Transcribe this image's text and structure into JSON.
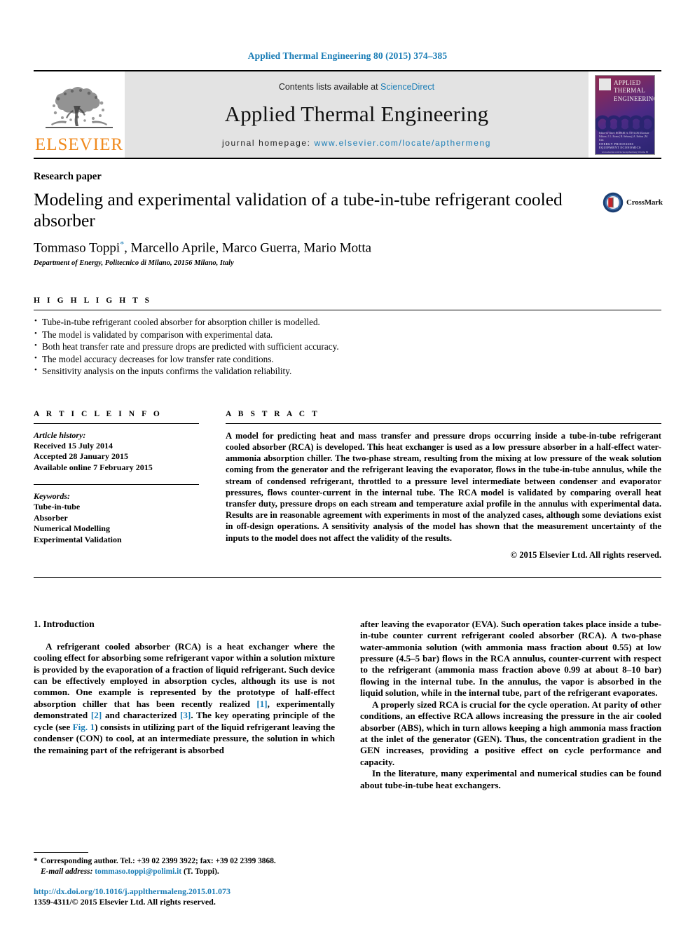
{
  "running_head": "Applied Thermal Engineering 80 (2015) 374–385",
  "masthead": {
    "publisher": "ELSEVIER",
    "contents_prefix": "Contents lists available at ",
    "contents_link": "ScienceDirect",
    "journal_title": "Applied Thermal Engineering",
    "homepage_label": "journal homepage:",
    "homepage_url": "www.elsevier.com/locate/apthermeng",
    "cover": {
      "title_line1": "APPLIED",
      "title_line2": "THERMAL",
      "title_line3": "ENGINEERING",
      "editors": "Editor-in-Chief: ROBERT A. TAYLOR\nAssociate Editors: J. L. Evans  |  R. Selvaraj  |  A. Kribus  |  M. Kim",
      "names": "ENERGY   PROCESSES   EQUIPMENT   ECONOMICS",
      "bottom": "www.elsevier.com/locate/apthermeng\nVolume 80"
    }
  },
  "article": {
    "type": "Research paper",
    "title": "Modeling and experimental validation of a tube-in-tube refrigerant cooled absorber",
    "crossmark_label": "CrossMark",
    "authors": "Tommaso Toppi",
    "author_marker": "*",
    "authors_rest": ", Marcello Aprile, Marco Guerra, Mario Motta",
    "affiliation": "Department of Energy, Politecnico di Milano, 20156 Milano, Italy"
  },
  "highlights": {
    "label": "H I G H L I G H T S",
    "items": [
      "Tube-in-tube refrigerant cooled absorber for absorption chiller is modelled.",
      "The model is validated by comparison with experimental data.",
      "Both heat transfer rate and pressure drops are predicted with sufficient accuracy.",
      "The model accuracy decreases for low transfer rate conditions.",
      "Sensitivity analysis on the inputs confirms the validation reliability."
    ]
  },
  "article_info": {
    "label": "A R T I C L E   I N F O",
    "history_heading": "Article history:",
    "history": [
      "Received 15 July 2014",
      "Accepted 28 January 2015",
      "Available online 7 February 2015"
    ],
    "keywords_heading": "Keywords:",
    "keywords": [
      "Tube-in-tube",
      "Absorber",
      "Numerical Modelling",
      "Experimental Validation"
    ]
  },
  "abstract": {
    "label": "A B S T R A C T",
    "text": "A model for predicting heat and mass transfer and pressure drops occurring inside a tube-in-tube refrigerant cooled absorber (RCA) is developed. This heat exchanger is used as a low pressure absorber in a half-effect water-ammonia absorption chiller. The two-phase stream, resulting from the mixing at low pressure of the weak solution coming from the generator and the refrigerant leaving the evaporator, flows in the tube-in-tube annulus, while the stream of condensed refrigerant, throttled to a pressure level intermediate between condenser and evaporator pressures, flows counter-current in the internal tube. The RCA model is validated by comparing overall heat transfer duty, pressure drops on each stream and temperature axial profile in the annulus with experimental data. Results are in reasonable agreement with experiments in most of the analyzed cases, although some deviations exist in off-design operations. A sensitivity analysis of the model has shown that the measurement uncertainty of the inputs to the model does not affect the validity of the results.",
    "copyright": "© 2015 Elsevier Ltd. All rights reserved."
  },
  "body": {
    "section_title": "1.  Introduction",
    "left_paragraphs": [
      "A refrigerant cooled absorber (RCA) is a heat exchanger where the cooling effect for absorbing some refrigerant vapor within a solution mixture is provided by the evaporation of a fraction of liquid refrigerant. Such device can be effectively employed in absorption cycles, although its use is not common. One example is represented by the prototype of half-effect absorption chiller that has been recently realized [1], experimentally demonstrated [2] and characterized [3]. The key operating principle of the cycle (see Fig. 1) consists in utilizing part of the liquid refrigerant leaving the condenser (CON) to cool, at an intermediate pressure, the solution in which the remaining part of the refrigerant is absorbed"
    ],
    "right_paragraphs": [
      "after leaving the evaporator (EVA). Such operation takes place inside a tube-in-tube counter current refrigerant cooled absorber (RCA). A two-phase water-ammonia solution (with ammonia mass fraction about 0.55) at low pressure (4.5–5 bar) flows in the RCA annulus, counter-current with respect to the refrigerant (ammonia mass fraction above 0.99 at about 8–10 bar) flowing in the internal tube. In the annulus, the vapor is absorbed in the liquid solution, while in the internal tube, part of the refrigerant evaporates.",
      "A properly sized RCA is crucial for the cycle operation. At parity of other conditions, an effective RCA allows increasing the pressure in the air cooled absorber (ABS), which in turn allows keeping a high ammonia mass fraction at the inlet of the generator (GEN). Thus, the concentration gradient in the GEN increases, providing a positive effect on cycle performance and capacity.",
      "In the literature, many experimental and numerical studies can be found about tube-in-tube heat exchangers."
    ],
    "inline_links": [
      "[1]",
      "[2]",
      "[3]",
      "Fig. 1"
    ]
  },
  "footer": {
    "corresponding_marker": "*",
    "corresponding_text": "Corresponding author. Tel.: +39 02 2399 3922; fax: +39 02 2399 3868.",
    "email_label": "E-mail address:",
    "email": "tommaso.toppi@polimi.it",
    "email_owner": "(T. Toppi).",
    "doi": "http://dx.doi.org/10.1016/j.applthermaleng.2015.01.073",
    "issn": "1359-4311/© 2015 Elsevier Ltd. All rights reserved."
  },
  "colors": {
    "link": "#1a7db6",
    "elsevier_orange": "#f08a1e",
    "masthead_bg": "#e3e3e3"
  }
}
